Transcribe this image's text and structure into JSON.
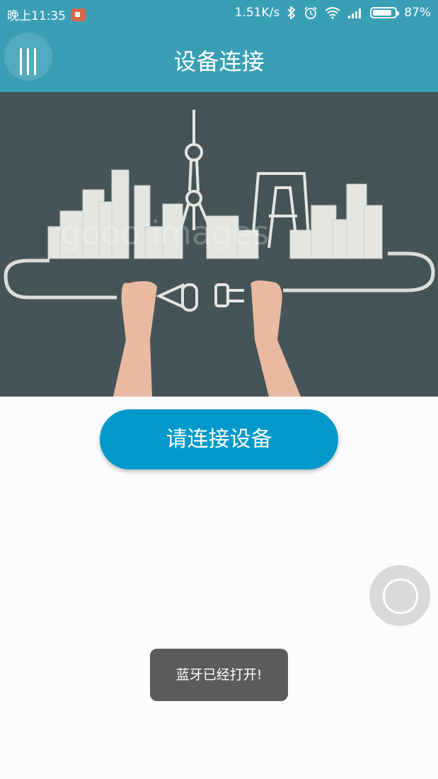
{
  "status_bar": {
    "time": "晚上11:35",
    "net_speed": "1.51K/s",
    "battery_percent": "87%",
    "battery_level": 0.87,
    "icons": [
      "bluetooth-icon",
      "alarm-icon",
      "wifi-icon",
      "signal-icon",
      "battery-icon"
    ]
  },
  "app_bar": {
    "title": "设备连接",
    "menu_icon": "menu-icon"
  },
  "hero": {
    "watermark": "gooo images"
  },
  "main": {
    "connect_button_label": "请连接设备"
  },
  "toast": {
    "message": "蓝牙已经打开!"
  },
  "colors": {
    "primary": "#399fb5",
    "button": "#0199cb",
    "hero_bg": "#455557",
    "toast_bg": "#5a5b5a"
  }
}
